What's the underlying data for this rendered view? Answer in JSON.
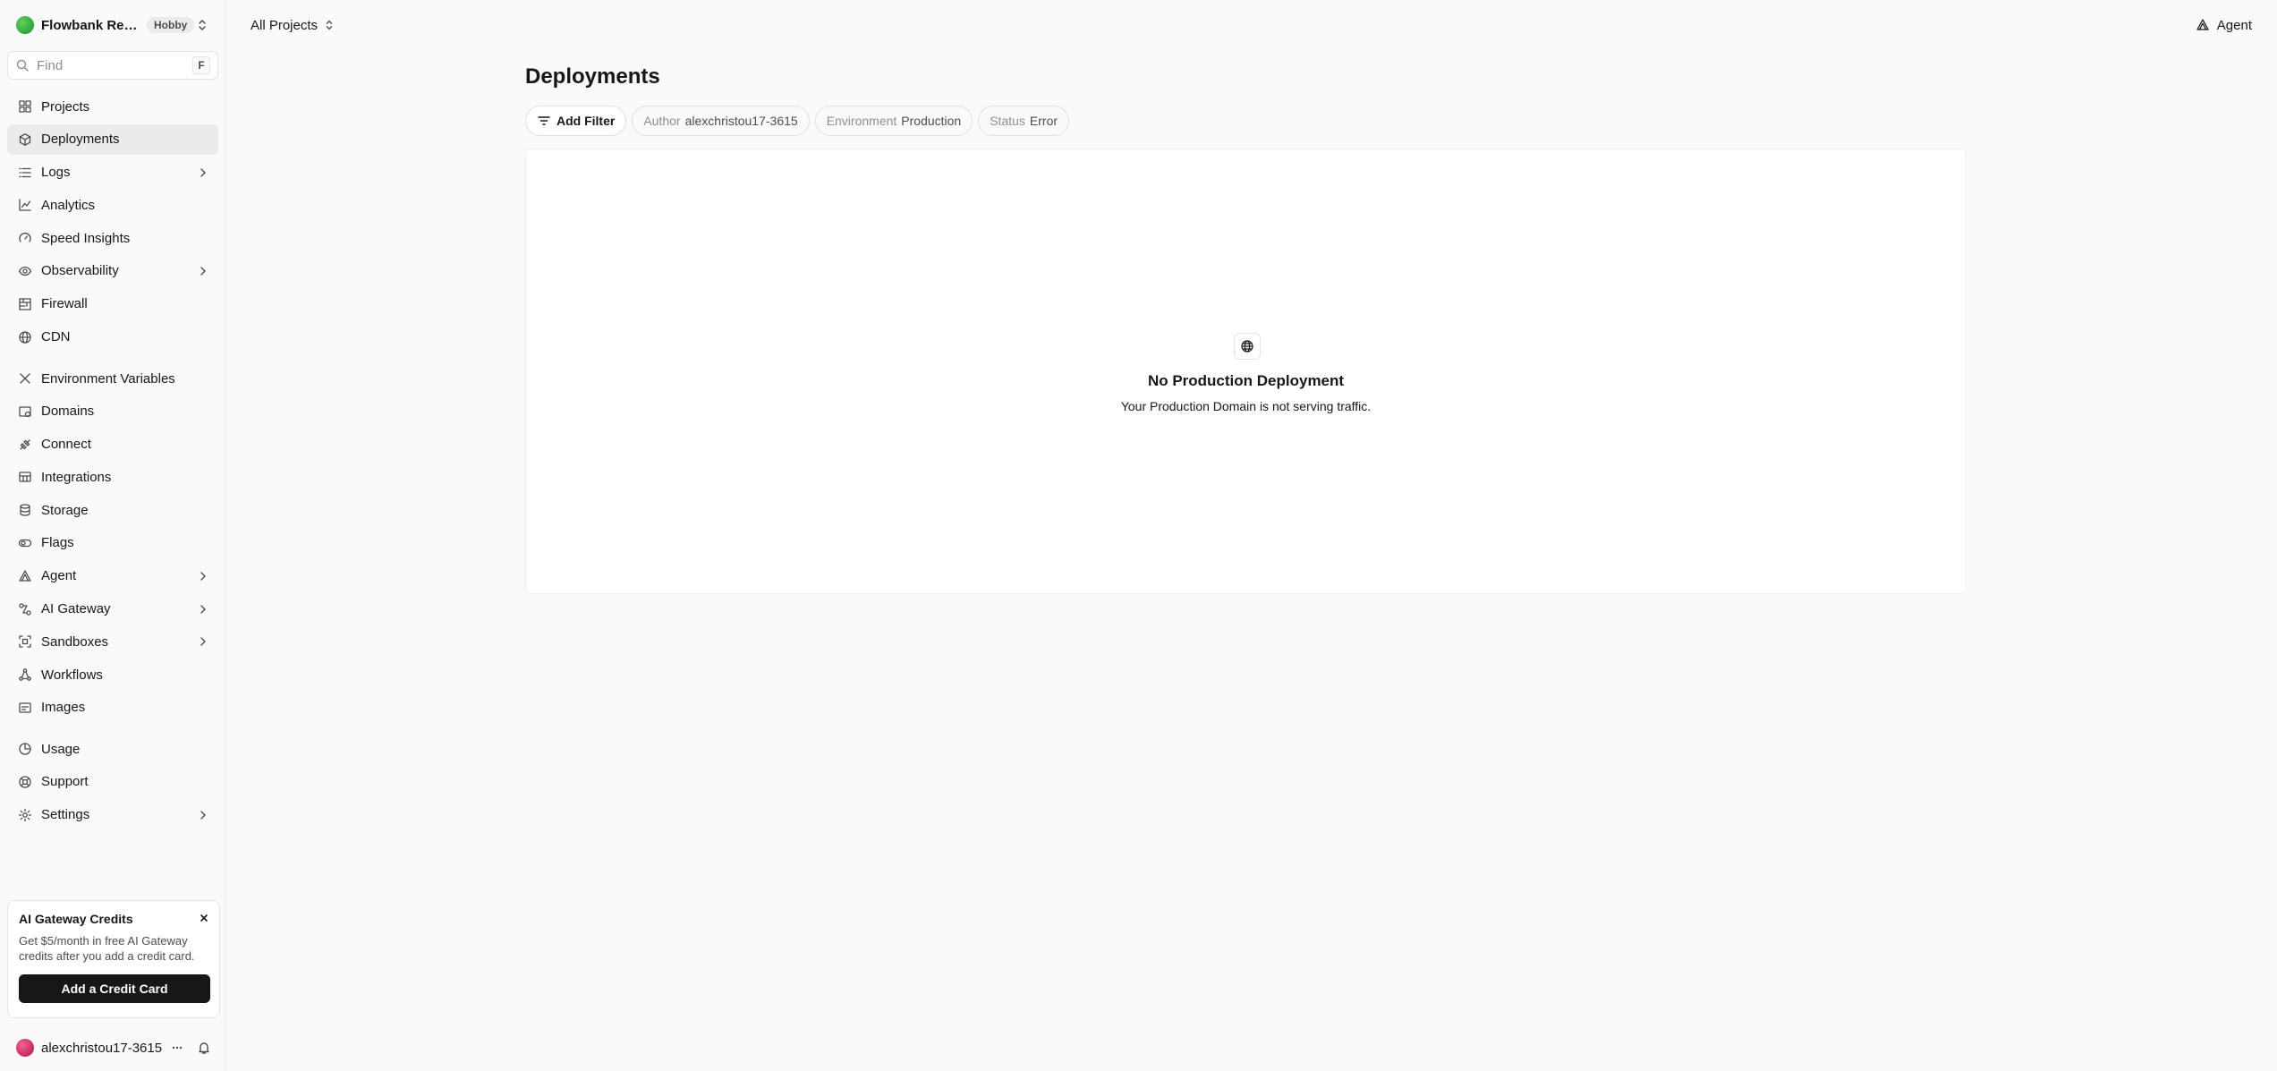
{
  "team": {
    "name": "Flowbank Rese...",
    "plan": "Hobby"
  },
  "search": {
    "placeholder": "Find",
    "shortcut": "F"
  },
  "nav_primary": [
    {
      "label": "Projects",
      "icon": "grid-icon",
      "chevron": false,
      "active": false
    },
    {
      "label": "Deployments",
      "icon": "cube-icon",
      "chevron": false,
      "active": true
    },
    {
      "label": "Logs",
      "icon": "list-icon",
      "chevron": true,
      "active": false
    },
    {
      "label": "Analytics",
      "icon": "line-chart-icon",
      "chevron": false,
      "active": false
    },
    {
      "label": "Speed Insights",
      "icon": "gauge-icon",
      "chevron": false,
      "active": false
    },
    {
      "label": "Observability",
      "icon": "eye-icon",
      "chevron": true,
      "active": false
    },
    {
      "label": "Firewall",
      "icon": "firewall-icon",
      "chevron": false,
      "active": false
    },
    {
      "label": "CDN",
      "icon": "globe-icon",
      "chevron": false,
      "active": false
    }
  ],
  "nav_secondary": [
    {
      "label": "Environment Variables",
      "icon": "variables-icon",
      "chevron": false
    },
    {
      "label": "Domains",
      "icon": "domain-icon",
      "chevron": false
    },
    {
      "label": "Connect",
      "icon": "connect-icon",
      "chevron": false
    },
    {
      "label": "Integrations",
      "icon": "integrations-icon",
      "chevron": false
    },
    {
      "label": "Storage",
      "icon": "database-icon",
      "chevron": false
    },
    {
      "label": "Flags",
      "icon": "toggle-icon",
      "chevron": false
    },
    {
      "label": "Agent",
      "icon": "agent-icon",
      "chevron": true
    },
    {
      "label": "AI Gateway",
      "icon": "gateway-icon",
      "chevron": true
    },
    {
      "label": "Sandboxes",
      "icon": "sandbox-icon",
      "chevron": true
    },
    {
      "label": "Workflows",
      "icon": "workflow-icon",
      "chevron": false
    },
    {
      "label": "Images",
      "icon": "image-icon",
      "chevron": false
    }
  ],
  "nav_tertiary": [
    {
      "label": "Usage",
      "icon": "pie-icon",
      "chevron": false
    },
    {
      "label": "Support",
      "icon": "lifebuoy-icon",
      "chevron": false
    },
    {
      "label": "Settings",
      "icon": "gear-icon",
      "chevron": true
    }
  ],
  "promo": {
    "title": "AI Gateway Credits",
    "text": "Get $5/month in free AI Gateway credits after you add a credit card.",
    "button": "Add a Credit Card"
  },
  "user": {
    "name": "alexchristou17-3615"
  },
  "topbar": {
    "project_selector": "All Projects",
    "agent_label": "Agent"
  },
  "page": {
    "title": "Deployments"
  },
  "filters": {
    "add_label": "Add Filter",
    "chips": [
      {
        "key": "Author",
        "value": "alexchristou17-3615"
      },
      {
        "key": "Environment",
        "value": "Production"
      },
      {
        "key": "Status",
        "value": "Error"
      }
    ]
  },
  "empty_state": {
    "icon": "globe-icon",
    "title": "No Production Deployment",
    "text": "Your Production Domain is not serving traffic."
  }
}
